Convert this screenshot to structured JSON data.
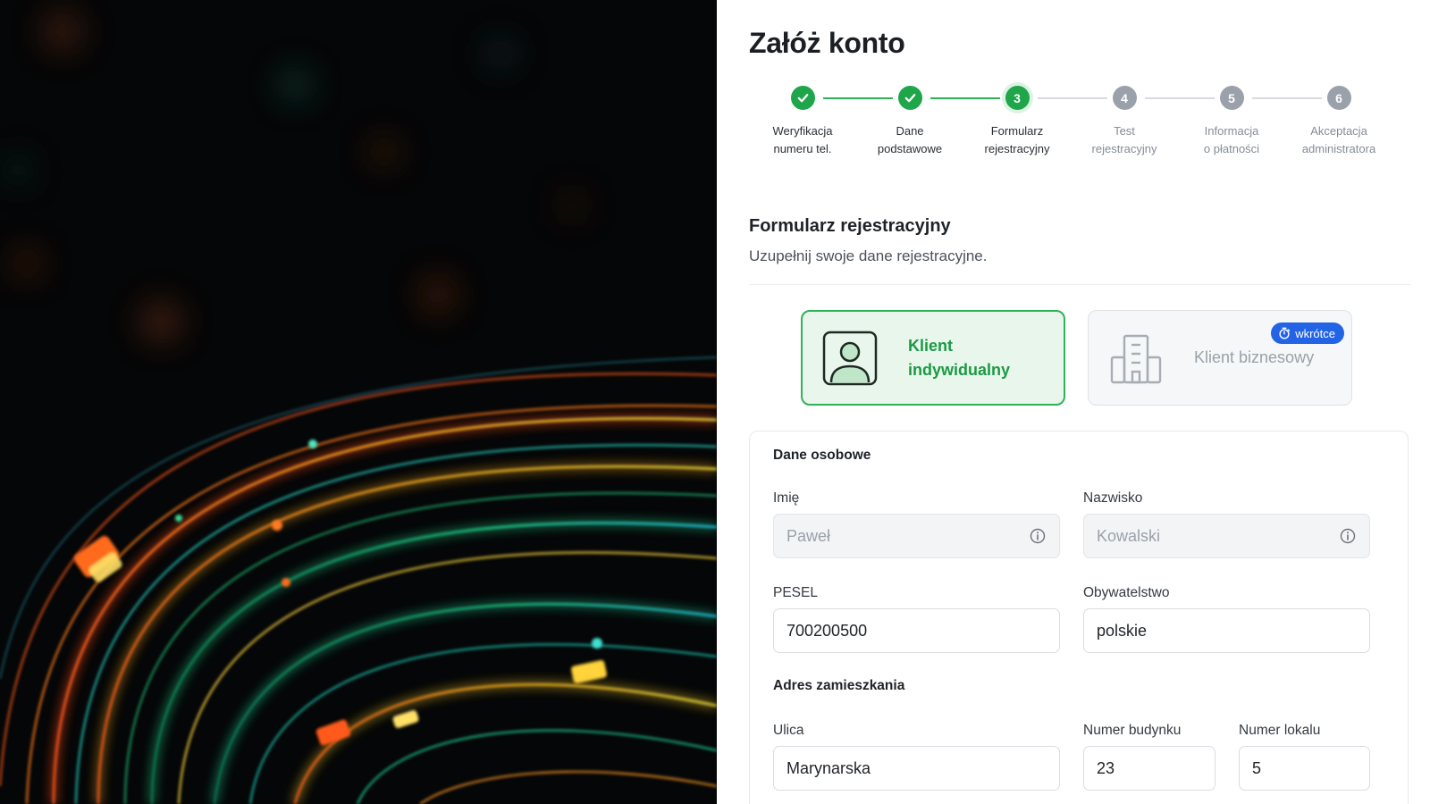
{
  "page": {
    "title": "Załóż konto"
  },
  "stepper": {
    "steps": [
      {
        "number": "1",
        "label": "Weryfikacja\nnumeru tel.",
        "state": "done"
      },
      {
        "number": "2",
        "label": "Dane\npodstawowe",
        "state": "done"
      },
      {
        "number": "3",
        "label": "Formularz\nrejestracyjny",
        "state": "active"
      },
      {
        "number": "4",
        "label": "Test\nrejestracyjny",
        "state": "pending"
      },
      {
        "number": "5",
        "label": "Informacja\no płatności",
        "state": "pending"
      },
      {
        "number": "6",
        "label": "Akceptacja\nadministratora",
        "state": "pending"
      }
    ]
  },
  "section": {
    "title": "Formularz rejestracyjny",
    "subtitle": "Uzupełnij swoje dane rejestracyjne."
  },
  "client_types": {
    "individual": {
      "label": "Klient indywidualny",
      "selected": true,
      "icon": "user-profile-icon"
    },
    "business": {
      "label": "Klient biznesowy",
      "selected": false,
      "icon": "building-icon",
      "badge": "wkrótce",
      "badge_icon": "stopwatch-icon"
    }
  },
  "personal": {
    "title": "Dane osobowe",
    "first_name": {
      "label": "Imię",
      "value": "Paweł"
    },
    "last_name": {
      "label": "Nazwisko",
      "value": "Kowalski"
    },
    "pesel": {
      "label": "PESEL",
      "value": "700200500"
    },
    "citizenship": {
      "label": "Obywatelstwo",
      "value": "polskie"
    }
  },
  "address": {
    "title": "Adres zamieszkania",
    "street": {
      "label": "Ulica",
      "value": "Marynarska"
    },
    "building": {
      "label": "Numer budynku",
      "value": "23"
    },
    "apartment": {
      "label": "Numer lokalu",
      "value": "5"
    }
  },
  "colors": {
    "accent": "#1fa54a",
    "pending": "#9aa1ab",
    "badge": "#2364e6",
    "hero_background": "#050607"
  }
}
